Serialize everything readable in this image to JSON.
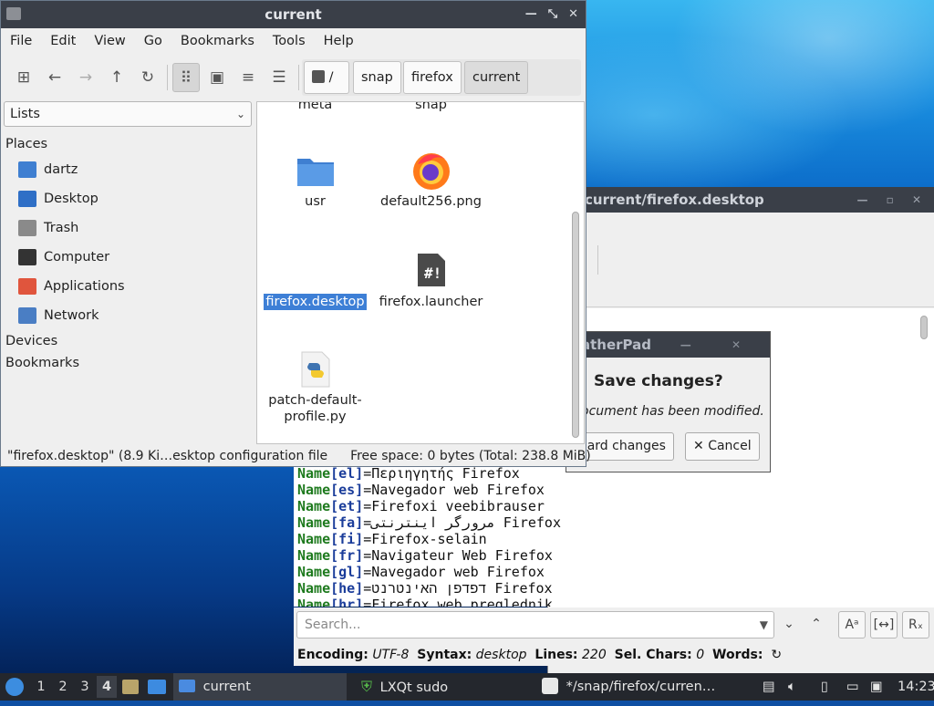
{
  "filemanager": {
    "title": "current",
    "menu": [
      "File",
      "Edit",
      "View",
      "Go",
      "Bookmarks",
      "Tools",
      "Help"
    ],
    "breadcrumbs": [
      "/",
      "snap",
      "firefox",
      "current"
    ],
    "side_select": "Lists",
    "places_heading": "Places",
    "places": [
      {
        "label": "dartz",
        "icon": "home-folder-icon"
      },
      {
        "label": "Desktop",
        "icon": "desktop-icon"
      },
      {
        "label": "Trash",
        "icon": "trash-icon"
      },
      {
        "label": "Computer",
        "icon": "computer-icon"
      },
      {
        "label": "Applications",
        "icon": "applications-icon"
      },
      {
        "label": "Network",
        "icon": "network-icon"
      }
    ],
    "devices_heading": "Devices",
    "bookmarks_heading": "Bookmarks",
    "files": [
      {
        "name": "meta",
        "icon": "folder-icon"
      },
      {
        "name": "snap",
        "icon": "folder-icon"
      },
      {
        "name": "usr",
        "icon": "folder-icon"
      },
      {
        "name": "default256.png",
        "icon": "firefox-logo-icon"
      },
      {
        "name": "firefox.desktop",
        "icon": "text-file-icon",
        "selected": true
      },
      {
        "name": "firefox.launcher",
        "icon": "script-file-icon"
      },
      {
        "name": "patch-default-profile.py",
        "name_line1": "patch-default-",
        "name_line2": "profile.py",
        "icon": "python-file-icon"
      }
    ],
    "status_left": "\"firefox.desktop\" (8.9 Ki…esktop configuration file",
    "status_right": "Free space: 0 bytes (Total: 238.8 MiB)"
  },
  "featherpad": {
    "title_fragment": "current/firefox.desktop",
    "code_lines": [
      {
        "key": "Name",
        "lang": "el",
        "value": "Περιηγητής Firefox"
      },
      {
        "key": "Name",
        "lang": "es",
        "value": "Navegador web Firefox"
      },
      {
        "key": "Name",
        "lang": "et",
        "value": "Firefoxi veebibrauser"
      },
      {
        "key": "Name",
        "lang": "fa",
        "value": "مرورگر اینترنتی Firefox"
      },
      {
        "key": "Name",
        "lang": "fi",
        "value": "Firefox-selain"
      },
      {
        "key": "Name",
        "lang": "fr",
        "value": "Navigateur Web Firefox"
      },
      {
        "key": "Name",
        "lang": "gl",
        "value": "Navegador web Firefox"
      },
      {
        "key": "Name",
        "lang": "he",
        "value": "דפדפן האינטרנט Firefox"
      },
      {
        "key": "Name",
        "lang": "hr",
        "value": "Firefox web preglednik"
      }
    ],
    "search_placeholder": "Search...",
    "status": {
      "encoding_label": "Encoding:",
      "encoding": "UTF-8",
      "syntax_label": "Syntax:",
      "syntax": "desktop",
      "lines_label": "Lines:",
      "lines": "220",
      "sel_label": "Sel. Chars:",
      "sel": "0",
      "words_label": "Words:"
    }
  },
  "dialog": {
    "title": "atherPad",
    "heading": "Save changes?",
    "message": "ocument has been modified.",
    "discard_label": "card changes",
    "cancel_label": "Cancel"
  },
  "taskbar": {
    "desktops": [
      "1",
      "2",
      "3",
      "4"
    ],
    "active_desktop": "4",
    "tasks": [
      {
        "label": "current",
        "icon": "folder-icon"
      },
      {
        "label": "LXQt sudo",
        "icon": "shield-icon"
      },
      {
        "label": "*/snap/firefox/curren…",
        "icon": "featherpad-icon"
      }
    ],
    "clock": "14:23"
  }
}
